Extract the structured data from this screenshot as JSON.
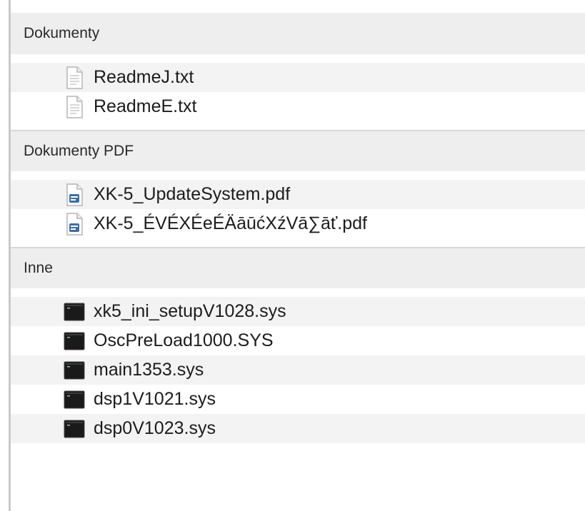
{
  "colors": {
    "header_bg": "#eeeeee",
    "stripe_bg": "#f3f3f3",
    "text": "#1c1c1c",
    "terminal_icon": "#1a1a1a",
    "pdf_badge": "#3d6fa8"
  },
  "groups": [
    {
      "title": "Dokumenty",
      "icon": "text-file-icon",
      "items": [
        {
          "label": "ReadmeJ.txt"
        },
        {
          "label": "ReadmeE.txt"
        }
      ]
    },
    {
      "title": "Dokumenty PDF",
      "icon": "pdf-file-icon",
      "items": [
        {
          "label": "XK-5_UpdateSystem.pdf"
        },
        {
          "label": "XK-5_ÉVÉXÉeÉÄāūćXźVā∑āť.pdf"
        }
      ]
    },
    {
      "title": "Inne",
      "icon": "terminal-file-icon",
      "items": [
        {
          "label": "xk5_ini_setupV1028.sys"
        },
        {
          "label": "OscPreLoad1000.SYS"
        },
        {
          "label": "main1353.sys"
        },
        {
          "label": "dsp1V1021.sys"
        },
        {
          "label": "dsp0V1023.sys"
        }
      ]
    }
  ]
}
